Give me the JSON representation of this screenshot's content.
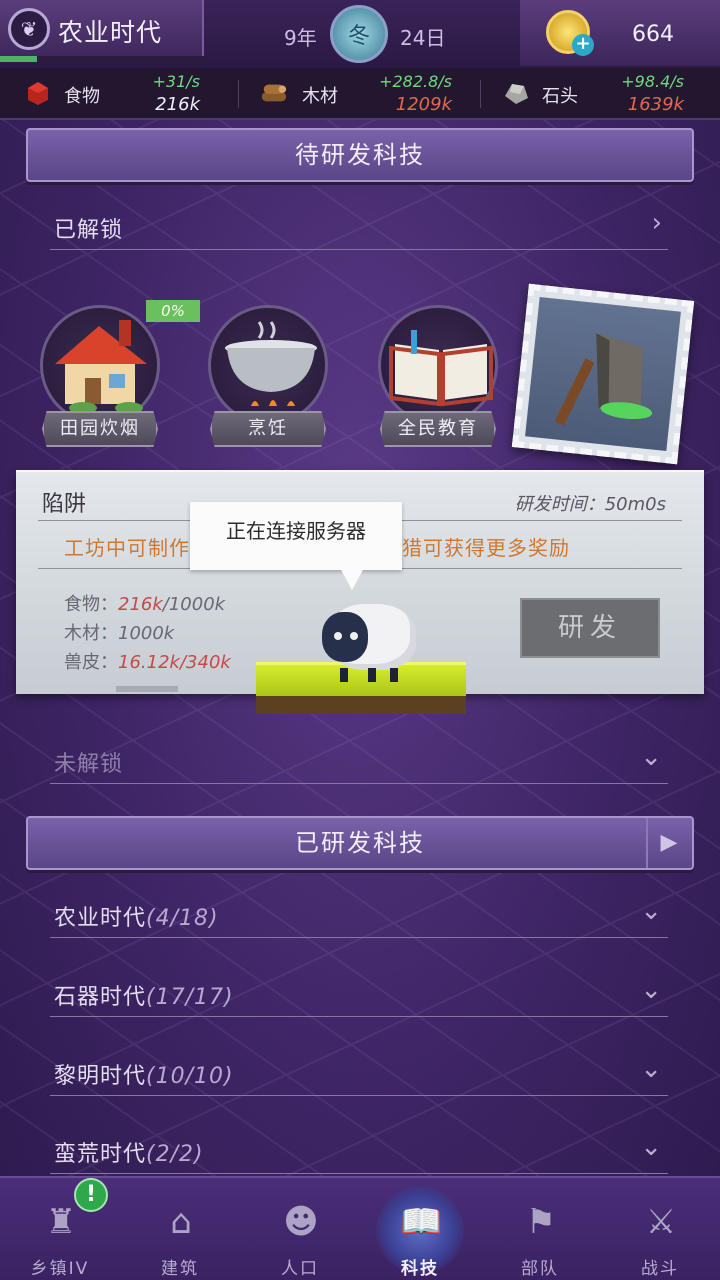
{
  "header": {
    "era_name": "农业时代",
    "era_progress": 0.18,
    "year": "9年",
    "season": "冬",
    "day": "24日",
    "gold": "664"
  },
  "resources": [
    {
      "icon": "meat-icon",
      "name": "食物",
      "rate": "+31/s",
      "amount": "216k",
      "amount_color": "white"
    },
    {
      "icon": "wood-icon",
      "name": "木材",
      "rate": "+282.8/s",
      "amount": "1209k",
      "amount_color": "red"
    },
    {
      "icon": "stone-icon",
      "name": "石头",
      "rate": "+98.4/s",
      "amount": "1639k",
      "amount_color": "red"
    }
  ],
  "pending_section": {
    "title": "待研发科技",
    "unlocked_label": "已解锁",
    "locked_label": "未解锁"
  },
  "techs": [
    {
      "label": "田园炊烟",
      "icon": "cottage-icon"
    },
    {
      "label": "烹饪",
      "icon": "pot-icon"
    },
    {
      "label": "全民教育",
      "icon": "book-icon"
    }
  ],
  "tech_badge": "0%",
  "detail": {
    "title": "陷阱",
    "time_label": "研发时间：50m0s",
    "desc_left": "工坊中可制作",
    "desc_right": "猎可获得更多奖励",
    "costs": [
      {
        "name": "食物：",
        "have": "216k",
        "need": "/1000k",
        "short": true
      },
      {
        "name": "木材：",
        "have": "",
        "need": "1000k",
        "short": false
      },
      {
        "name": "兽皮：",
        "have": "16.12k",
        "need": "/340k",
        "short": true
      }
    ],
    "research_button": "研发"
  },
  "loading": {
    "message": "正在连接服务器"
  },
  "researched_section": {
    "title": "已研发科技",
    "eras": [
      {
        "name": "农业时代",
        "count": "(4/18)"
      },
      {
        "name": "石器时代",
        "count": "(17/17)"
      },
      {
        "name": "黎明时代",
        "count": "(10/10)"
      },
      {
        "name": "蛮荒时代",
        "count": "(2/2)"
      }
    ]
  },
  "nav": [
    {
      "label": "乡镇IV",
      "icon": "castle-icon",
      "alert": "!"
    },
    {
      "label": "建筑",
      "icon": "house-icon"
    },
    {
      "label": "人口",
      "icon": "person-icon"
    },
    {
      "label": "科技",
      "icon": "book-icon",
      "active": true
    },
    {
      "label": "部队",
      "icon": "banner-icon"
    },
    {
      "label": "战斗",
      "icon": "crossed-swords-icon"
    }
  ]
}
